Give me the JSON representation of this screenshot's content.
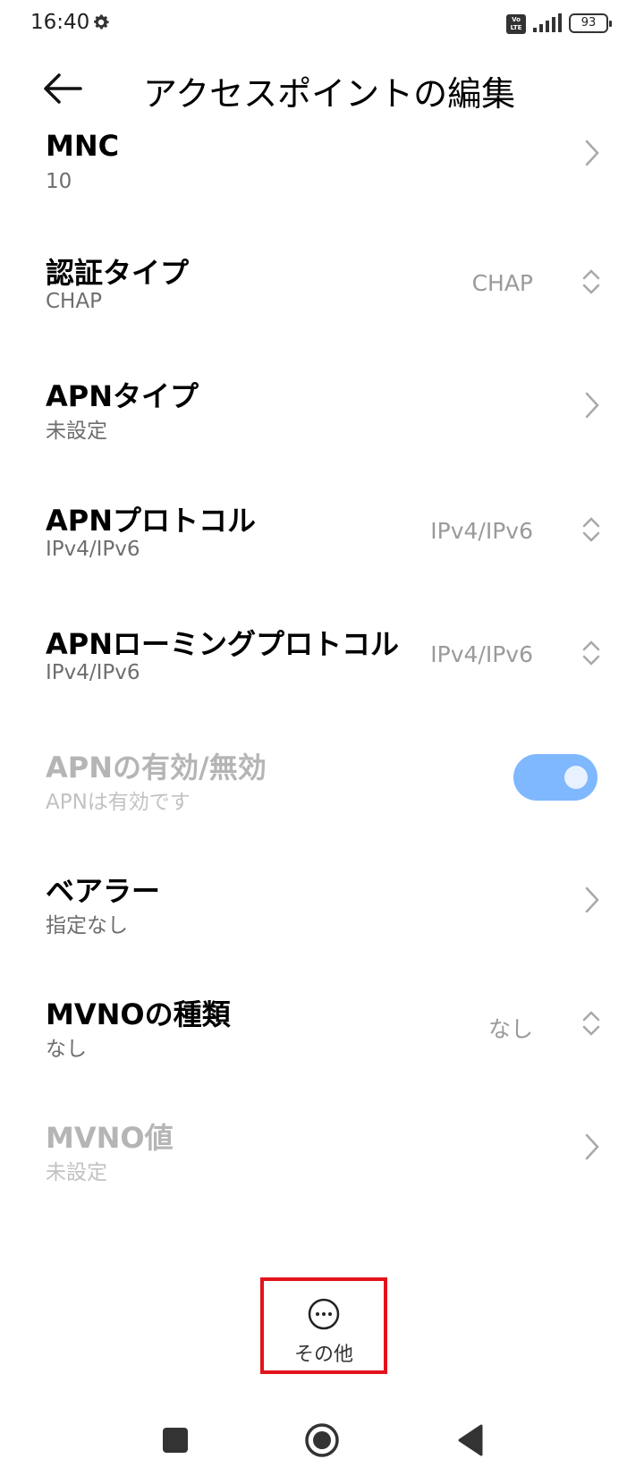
{
  "status_bar": {
    "time": "16:40",
    "volte": "Vo LTE",
    "battery": "93"
  },
  "header": {
    "title": "アクセスポイントの編集"
  },
  "rows": [
    {
      "title": "MNC",
      "subtitle": "10",
      "value": ""
    },
    {
      "title": "認証タイプ",
      "subtitle": "CHAP",
      "value": "CHAP"
    },
    {
      "title": "APNタイプ",
      "subtitle": "未設定",
      "value": ""
    },
    {
      "title": "APNプロトコル",
      "subtitle": "IPv4/IPv6",
      "value": "IPv4/IPv6"
    },
    {
      "title": "APNローミングプロトコル",
      "subtitle": "IPv4/IPv6",
      "value": "IPv4/IPv6"
    },
    {
      "title": "APNの有効/無効",
      "subtitle": "APNは有効です",
      "toggle_on": true
    },
    {
      "title": "ベアラー",
      "subtitle": "指定なし",
      "value": ""
    },
    {
      "title": "MVNOの種類",
      "subtitle": "なし",
      "value": "なし"
    },
    {
      "title": "MVNO値",
      "subtitle": "未設定",
      "value": ""
    }
  ],
  "more_button": {
    "label": "その他"
  },
  "colors": {
    "toggle_on": "#7fb8ff",
    "highlight_border": "#e3131b",
    "disabled_text": "#b5b5b5"
  }
}
